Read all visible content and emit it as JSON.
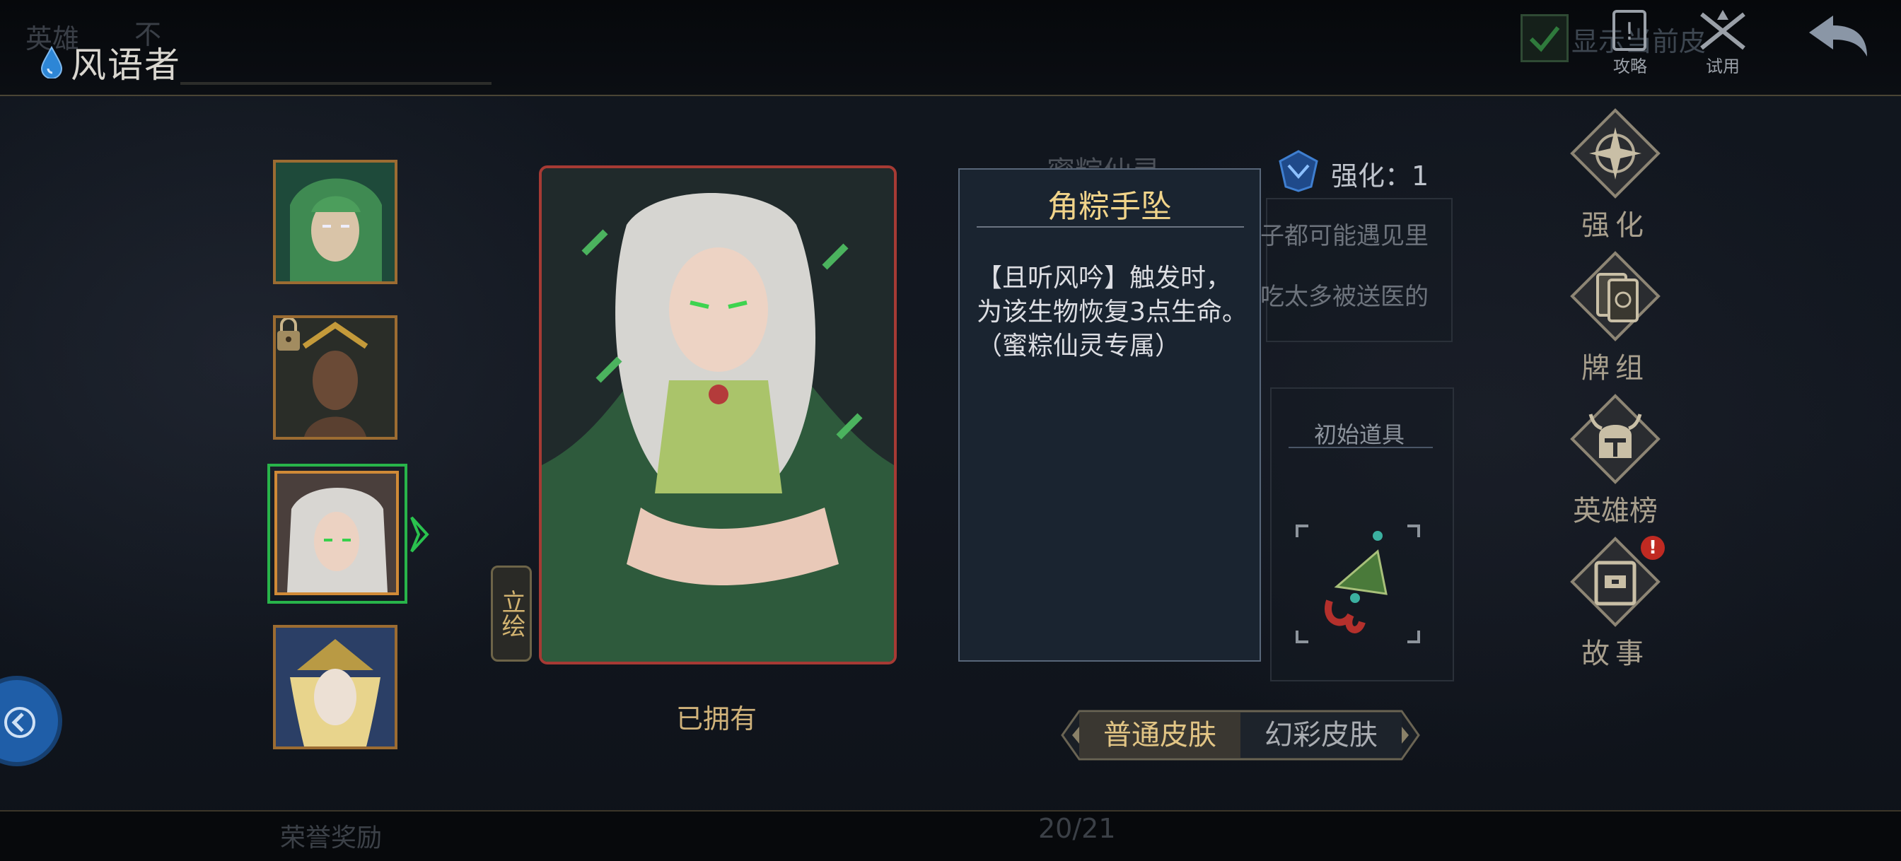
{
  "header": {
    "title": "风语者",
    "faded_label_left": "英雄",
    "faded_label_left_2": "不",
    "show_skin_label": "显示当前皮",
    "guide_label": "攻略",
    "trial_label": "试用"
  },
  "hero_list": {
    "portraits": [
      "hero-1",
      "hero-2-locked",
      "hero-3-selected",
      "hero-4"
    ]
  },
  "card": {
    "side_tab_label": "立绘",
    "owned_label": "已拥有"
  },
  "tooltip": {
    "title": "角粽手坠",
    "body": "【且听风吟】触发时，为该生物恢复3点生命。（蜜粽仙灵专属）"
  },
  "behind": {
    "skin_name": "蜜粽仙灵",
    "enhance_level": "强化：1",
    "desc_line_1": "子都可能遇见里",
    "desc_line_2": "吃太多被送医的",
    "initial_item_label": "初始道具"
  },
  "right_menu": {
    "items": [
      {
        "label": "强化",
        "icon": "compass-star-icon"
      },
      {
        "label": "牌组",
        "icon": "cards-icon"
      },
      {
        "label": "英雄榜",
        "icon": "helmet-icon"
      },
      {
        "label": "故事",
        "icon": "book-icon"
      }
    ],
    "story_badge": "!"
  },
  "skin_switch": {
    "normal": "普通皮肤",
    "fantasy": "幻彩皮肤"
  },
  "footer": {
    "page_indicator": "20/21",
    "reward_label": "荣誉奖励"
  },
  "colors": {
    "accent_gold": "#d0b27a",
    "select_green": "#28b44a",
    "card_red": "#a63a34",
    "badge_red": "#c02a22"
  }
}
